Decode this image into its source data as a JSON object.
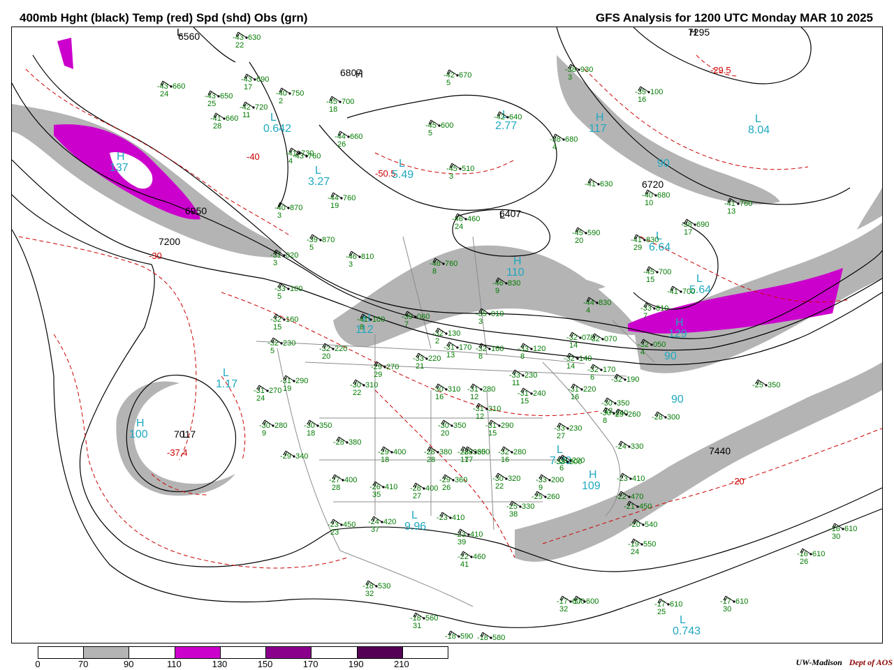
{
  "header": {
    "left_title": "400mb Hght (black) Temp (red) Spd (shd) Obs (grn)",
    "right_title": "GFS Analysis for 1200 UTC Monday  MAR 10 2025"
  },
  "colors": {
    "height": "#000000",
    "temperature": "#cc0000",
    "obs": "#007a00",
    "speed_label": "#1fa8c0",
    "shade_70_90": "#b4b4b4",
    "shade_110_130": "#cc00cc",
    "shade_150_170": "#8b008b",
    "shade_190_210": "#550055",
    "borders": "#8c8c8c"
  },
  "colorbar": {
    "segments": [
      {
        "from": "0",
        "to": "70",
        "color": "#ffffff"
      },
      {
        "from": "70",
        "to": "90",
        "color": "#b4b4b4"
      },
      {
        "from": "90",
        "to": "110",
        "color": "#ffffff"
      },
      {
        "from": "110",
        "to": "130",
        "color": "#cc00cc"
      },
      {
        "from": "130",
        "to": "150",
        "color": "#ffffff"
      },
      {
        "from": "150",
        "to": "170",
        "color": "#8b008b"
      },
      {
        "from": "170",
        "to": "190",
        "color": "#ffffff"
      },
      {
        "from": "190",
        "to": "210",
        "color": "#550055"
      },
      {
        "from": "210",
        "to": "",
        "color": "#ffffff"
      }
    ],
    "labels": [
      "0",
      "70",
      "90",
      "110",
      "130",
      "150",
      "170",
      "190",
      "210"
    ]
  },
  "credit": {
    "org": "UW-Madison",
    "dept": "Dept of AOS"
  },
  "height_labels": [
    "6560",
    "6807",
    "6950",
    "7200",
    "6407",
    "6720",
    "7440",
    "7017",
    "7295"
  ],
  "centers": [
    {
      "letter": "L",
      "value": "6560"
    },
    {
      "letter": "H",
      "value": "6807"
    },
    {
      "letter": "L",
      "value": "6407"
    },
    {
      "letter": "L",
      "value": "7017"
    },
    {
      "letter": "H",
      "value": "7295"
    }
  ],
  "temp_labels": [
    "-40",
    "-30",
    "-50.5",
    "-29.5",
    "-37.4",
    "-20"
  ],
  "speed_labels": [
    {
      "letter": "L",
      "value": "0.642"
    },
    {
      "letter": "H",
      "value": "137"
    },
    {
      "letter": "L",
      "value": "3.27"
    },
    {
      "letter": "L",
      "value": "5.49"
    },
    {
      "letter": "L",
      "value": "2.77"
    },
    {
      "letter": "H",
      "value": "117"
    },
    {
      "letter": "L",
      "value": "8.04"
    },
    {
      "letter": "L",
      "value": "6.64"
    },
    {
      "letter": "H",
      "value": "110"
    },
    {
      "letter": "H",
      "value": "112"
    },
    {
      "letter": "H",
      "value": "129"
    },
    {
      "letter": "L",
      "value": "1.17"
    },
    {
      "letter": "H",
      "value": "100"
    },
    {
      "letter": "L",
      "value": "9.96"
    },
    {
      "letter": "L",
      "value": "7.39"
    },
    {
      "letter": "H",
      "value": "109"
    },
    {
      "letter": "L",
      "value": "0.743"
    },
    {
      "letter": "",
      "value": "90"
    },
    {
      "letter": "",
      "value": "90"
    },
    {
      "letter": "",
      "value": "90"
    },
    {
      "letter": "L",
      "value": "5.64"
    }
  ],
  "observations": [
    {
      "t": "-43",
      "h": "630",
      "d": "22"
    },
    {
      "t": "-43",
      "h": "660",
      "d": "24"
    },
    {
      "t": "-43",
      "h": "690",
      "d": "17"
    },
    {
      "t": "-40",
      "h": "750",
      "d": "2"
    },
    {
      "t": "-43",
      "h": "650",
      "d": "25"
    },
    {
      "t": "-42",
      "h": "720",
      "d": "11"
    },
    {
      "t": "-41",
      "h": "660",
      "d": "28"
    },
    {
      "t": "-45",
      "h": "700",
      "d": "18"
    },
    {
      "t": "-42",
      "h": "670",
      "d": "5"
    },
    {
      "t": "-41",
      "h": "730",
      "d": "4"
    },
    {
      "t": "-43",
      "h": "760",
      "d": ""
    },
    {
      "t": "-44",
      "h": "660",
      "d": "26"
    },
    {
      "t": "-45",
      "h": "600",
      "d": "5"
    },
    {
      "t": "-42",
      "h": "640",
      "d": ""
    },
    {
      "t": "-38",
      "h": "680",
      "d": "4"
    },
    {
      "t": "-45",
      "h": "510",
      "d": "3"
    },
    {
      "t": "-41",
      "h": "630",
      "d": ""
    },
    {
      "t": "-38",
      "h": "930",
      "d": "3"
    },
    {
      "t": "-35",
      "h": "100",
      "d": "16"
    },
    {
      "t": "-40",
      "h": "870",
      "d": "3"
    },
    {
      "t": "-44",
      "h": "760",
      "d": "19"
    },
    {
      "t": "-46",
      "h": "460",
      "d": "24"
    },
    {
      "t": "-45",
      "h": "590",
      "d": "20"
    },
    {
      "t": "-40",
      "h": "680",
      "d": "10"
    },
    {
      "t": "-41",
      "h": "760",
      "d": "13"
    },
    {
      "t": "-39",
      "h": "870",
      "d": "5"
    },
    {
      "t": "-46",
      "h": "810",
      "d": "3"
    },
    {
      "t": "-41",
      "h": "830",
      "d": "29"
    },
    {
      "t": "-38",
      "h": "690",
      "d": "17"
    },
    {
      "t": "-31",
      "h": "020",
      "d": "3"
    },
    {
      "t": "-46",
      "h": "760",
      "d": "8"
    },
    {
      "t": "-33",
      "h": "100",
      "d": "5"
    },
    {
      "t": "-46",
      "h": "830",
      "d": "9"
    },
    {
      "t": "-45",
      "h": "700",
      "d": "15"
    },
    {
      "t": "-41",
      "h": "700",
      "d": ""
    },
    {
      "t": "-44",
      "h": "830",
      "d": "4"
    },
    {
      "t": "-33",
      "h": "810",
      "d": "7"
    },
    {
      "t": "-32",
      "h": "160",
      "d": "15"
    },
    {
      "t": "-41",
      "h": "100",
      "d": "8"
    },
    {
      "t": "-39",
      "h": "060",
      "d": "7"
    },
    {
      "t": "-35",
      "h": "010",
      "d": "3"
    },
    {
      "t": "-32",
      "h": "230",
      "d": "5"
    },
    {
      "t": "-32",
      "h": "220",
      "d": "20"
    },
    {
      "t": "-32",
      "h": "130",
      "d": "2"
    },
    {
      "t": "-31",
      "h": "170",
      "d": "13"
    },
    {
      "t": "-32",
      "h": "160",
      "d": "8"
    },
    {
      "t": "-33",
      "h": "120",
      "d": "8"
    },
    {
      "t": "-32",
      "h": "070",
      "d": "14"
    },
    {
      "t": "-32",
      "h": "070",
      "d": ""
    },
    {
      "t": "-32",
      "h": "050",
      "d": "4"
    },
    {
      "t": "-29",
      "h": "270",
      "d": "29"
    },
    {
      "t": "-33",
      "h": "220",
      "d": "21"
    },
    {
      "t": "-32",
      "h": "140",
      "d": "14"
    },
    {
      "t": "-32",
      "h": "170",
      "d": "6"
    },
    {
      "t": "-32",
      "h": "190",
      "d": ""
    },
    {
      "t": "-31",
      "h": "290",
      "d": "19"
    },
    {
      "t": "-30",
      "h": "310",
      "d": "22"
    },
    {
      "t": "-31",
      "h": "270",
      "d": "24"
    },
    {
      "t": "-30",
      "h": "310",
      "d": "16"
    },
    {
      "t": "-31",
      "h": "280",
      "d": "12"
    },
    {
      "t": "-33",
      "h": "230",
      "d": "11"
    },
    {
      "t": "-31",
      "h": "240",
      "d": "15"
    },
    {
      "t": "-31",
      "h": "220",
      "d": "16"
    },
    {
      "t": "-25",
      "h": "350",
      "d": ""
    },
    {
      "t": "-30",
      "h": "350",
      "d": "12"
    },
    {
      "t": "-31",
      "h": "310",
      "d": "12"
    },
    {
      "t": "-30",
      "h": "240",
      "d": "8"
    },
    {
      "t": "-29",
      "h": "260",
      "d": ""
    },
    {
      "t": "-28",
      "h": "300",
      "d": ""
    },
    {
      "t": "-30",
      "h": "280",
      "d": "9"
    },
    {
      "t": "-30",
      "h": "350",
      "d": "18"
    },
    {
      "t": "-30",
      "h": "350",
      "d": "20"
    },
    {
      "t": "-31",
      "h": "290",
      "d": "15"
    },
    {
      "t": "-33",
      "h": "230",
      "d": "27"
    },
    {
      "t": "-28",
      "h": "380",
      "d": ""
    },
    {
      "t": "-29",
      "h": "400",
      "d": "18"
    },
    {
      "t": "-28",
      "h": "380",
      "d": "28"
    },
    {
      "t": "-28",
      "h": "360",
      "d": "17"
    },
    {
      "t": "-28",
      "h": "350",
      "d": "17"
    },
    {
      "t": "-32",
      "h": "280",
      "d": "16"
    },
    {
      "t": "-33",
      "h": "200",
      "d": "6"
    },
    {
      "t": "-33",
      "h": "200",
      "d": ""
    },
    {
      "t": "-24",
      "h": "330",
      "d": ""
    },
    {
      "t": "-29",
      "h": "340",
      "d": ""
    },
    {
      "t": "-27",
      "h": "400",
      "d": "28"
    },
    {
      "t": "-26",
      "h": "410",
      "d": "35"
    },
    {
      "t": "-28",
      "h": "400",
      "d": "27"
    },
    {
      "t": "-29",
      "h": "360",
      "d": "26"
    },
    {
      "t": "-30",
      "h": "320",
      "d": "22"
    },
    {
      "t": "-33",
      "h": "200",
      "d": "9"
    },
    {
      "t": "-23",
      "h": "410",
      "d": ""
    },
    {
      "t": "-23",
      "h": "450",
      "d": "23"
    },
    {
      "t": "-24",
      "h": "420",
      "d": "37"
    },
    {
      "t": "-23",
      "h": "410",
      "d": ""
    },
    {
      "t": "-25",
      "h": "330",
      "d": "38"
    },
    {
      "t": "-25",
      "h": "260",
      "d": ""
    },
    {
      "t": "-22",
      "h": "470",
      "d": ""
    },
    {
      "t": "-21",
      "h": "450",
      "d": ""
    },
    {
      "t": "-23",
      "h": "410",
      "d": "39"
    },
    {
      "t": "-20",
      "h": "540",
      "d": ""
    },
    {
      "t": "-19",
      "h": "550",
      "d": "24"
    },
    {
      "t": "-22",
      "h": "460",
      "d": "41"
    },
    {
      "t": "-16",
      "h": "610",
      "d": "30"
    },
    {
      "t": "-16",
      "h": "610",
      "d": "26"
    },
    {
      "t": "-18",
      "h": "530",
      "d": "32"
    },
    {
      "t": "-17",
      "h": "600",
      "d": "32"
    },
    {
      "t": "-17",
      "h": "600",
      "d": ""
    },
    {
      "t": "-17",
      "h": "610",
      "d": "25"
    },
    {
      "t": "-17",
      "h": "610",
      "d": "30"
    },
    {
      "t": "-18",
      "h": "560",
      "d": "31"
    },
    {
      "t": "-18",
      "h": "590",
      "d": ""
    },
    {
      "t": "-18",
      "h": "580",
      "d": ""
    }
  ]
}
